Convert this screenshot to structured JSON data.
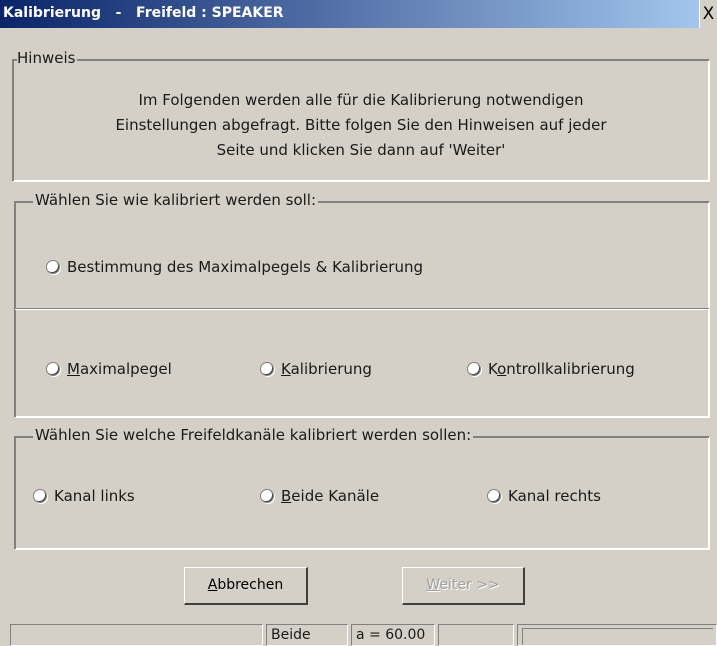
{
  "window": {
    "title": "Kalibrierung   -   Freifeld : SPEAKER",
    "close_symbol": "X"
  },
  "hinweis": {
    "legend": "Hinweis",
    "lines": [
      "Im Folgenden werden alle für die Kalibrierung notwendigen",
      "Einstellungen abgefragt. Bitte folgen Sie den Hinweisen auf jeder",
      "Seite und klicken Sie dann auf 'Weiter'"
    ]
  },
  "calibration_mode": {
    "legend": "Wählen Sie wie kalibriert werden soll:",
    "option_full": "Bestimmung des Maximalpegels & Kalibrierung",
    "option_max": {
      "underlined": "M",
      "rest": "aximalpegel"
    },
    "option_cal": {
      "underlined": "K",
      "rest": "alibrierung"
    },
    "option_ctrl": {
      "before": "K",
      "underlined": "o",
      "rest": "ntrollkalibrierung"
    }
  },
  "channels": {
    "legend": "Wählen Sie welche Freifeldkanäle kalibriert werden sollen:",
    "option_left": "Kanal links",
    "option_both": {
      "underlined": "B",
      "rest": "eide Kanäle"
    },
    "option_right": "Kanal rechts"
  },
  "buttons": {
    "cancel": {
      "underlined": "A",
      "rest": "bbrechen"
    },
    "next": {
      "underlined": "W",
      "rest": "eiter >>",
      "enabled": false
    }
  },
  "statusbar": {
    "cell1": "",
    "cell2": "Beide",
    "cell3": "a = 60.00",
    "cell4": "",
    "cell5": ""
  },
  "colors": {
    "title_gradient_start": "#0a246a",
    "title_gradient_end": "#a6caf0",
    "face": "#d4d0c8"
  }
}
